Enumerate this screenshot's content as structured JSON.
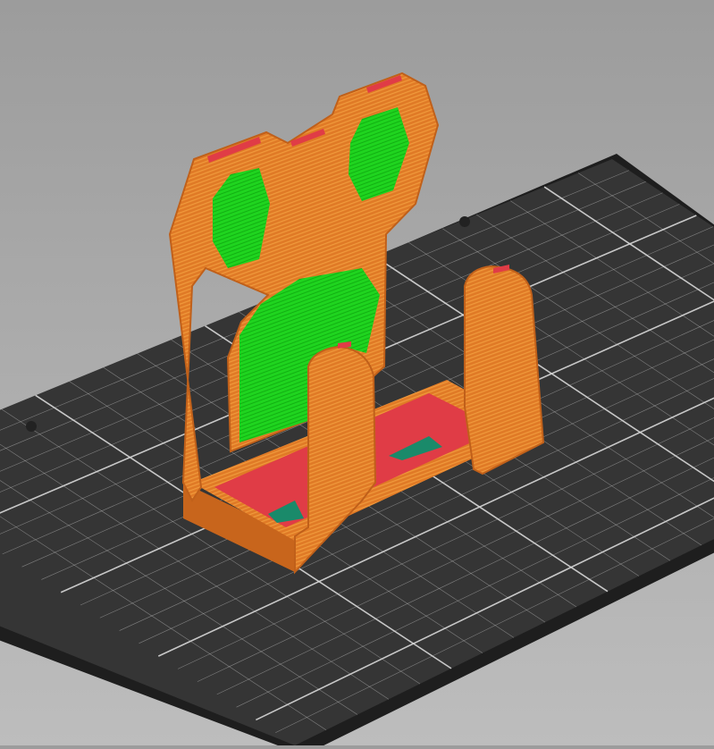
{
  "viewport": {
    "mode": "slice-preview",
    "colors": {
      "background_top": "#9c9c9c",
      "background_bottom": "#bdbdbd",
      "bed": "#333333",
      "bed_edge": "#1e1e1e",
      "grid": "#d8d8d8",
      "perimeter": "#e07a26",
      "perimeter_light": "#f0a040",
      "top_solid": "#e03c46",
      "bridge_infill": "#1fd41f",
      "solid_infill": "#1a8a6a"
    },
    "grid_divisions": 22
  }
}
